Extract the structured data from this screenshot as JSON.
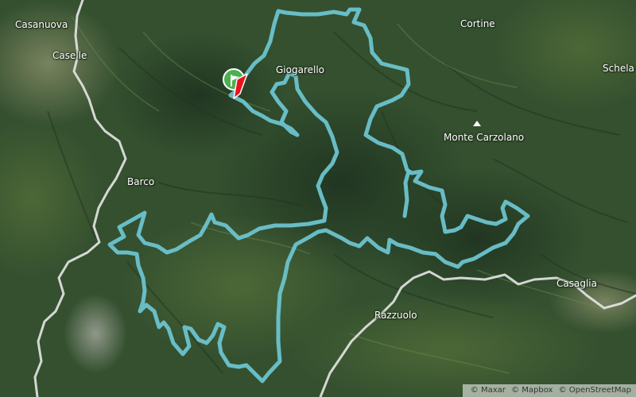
{
  "map": {
    "basemap": "satellite",
    "route_color": "#6cc3cf",
    "road_color": "#e6e6e6",
    "marker": {
      "kind": "start-finish",
      "colors": {
        "green": "#4caf50",
        "red": "#e8141c",
        "white": "#ffffff"
      }
    }
  },
  "places": {
    "casanuova": "Casanuova",
    "caselle": "Caselle",
    "giogarello": "Giogarello",
    "cortine": "Cortine",
    "schela": "Schela",
    "monte_carzolano": "Monte Carzolano",
    "barco": "Barco",
    "razzuolo": "Razzuolo",
    "casaglia": "Casaglia"
  },
  "attribution": {
    "maxar": "© Maxar",
    "mapbox": "© Mapbox",
    "osm": "© OpenStreetMap"
  }
}
